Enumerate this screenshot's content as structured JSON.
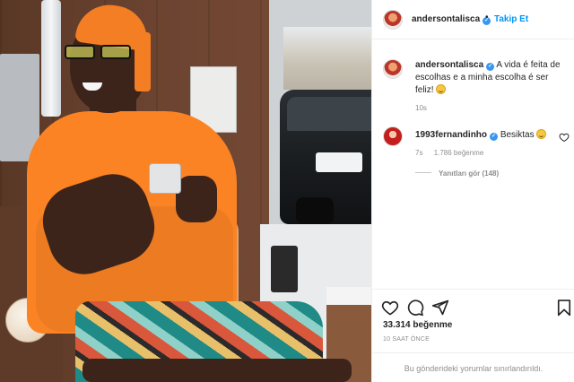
{
  "post": {
    "username": "andersontalisca",
    "verified": true,
    "follow_label": "Takip Et",
    "separator": "•"
  },
  "caption": {
    "username": "andersontalisca",
    "text": "A vida é feita de escolhas e a minha escolha é ser feliz!",
    "emoji": "smiling-face-emoji",
    "time": "10s"
  },
  "comment": {
    "username": "1993fernandinho",
    "text": "Besiktas",
    "emoji": "smiling-face-emoji",
    "time": "7s",
    "likes": "1.786 beğenme",
    "view_replies": "Yanıtları gör (148)"
  },
  "actions": {
    "like_icon": "heart-icon",
    "comment_icon": "comment-icon",
    "share_icon": "send-icon",
    "save_icon": "bookmark-icon",
    "likes_count": "33.314 beğenme",
    "posted_ago": "10 SAAT ÖNCE",
    "comments_limited": "Bu gönderideki yorumlar sınırlandırıldı."
  },
  "colors": {
    "link_blue": "#0095f6",
    "verified_blue": "#3897f0",
    "text_primary": "#262626",
    "text_secondary": "#8e8e8e",
    "shirt_orange": "#fb8324"
  }
}
